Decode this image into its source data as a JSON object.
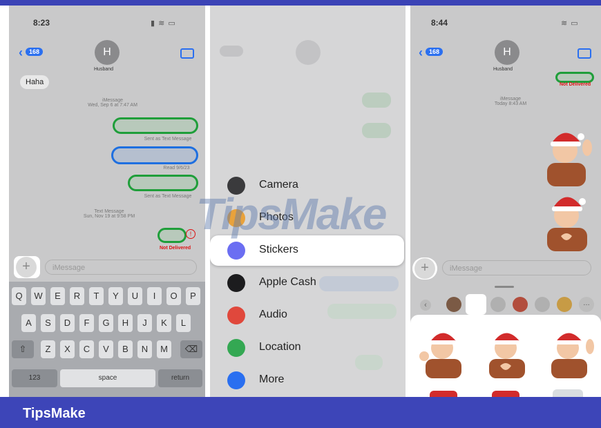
{
  "footer": {
    "title": "TipsMake"
  },
  "watermark": {
    "text": "TipsMake"
  },
  "panel_left": {
    "time": "8:23",
    "back_badge": "168",
    "avatar_initial": "H",
    "contact_name": "Husband",
    "incoming": "Haha",
    "meta1_line1": "iMessage",
    "meta1_line2": "Wed, Sep 6 at 7:47 AM",
    "sent_text_1": "Sent as Text Message",
    "read_receipt": "Read 9/6/23",
    "sent_text_2": "Sent as Text Message",
    "meta2_line1": "Text Message",
    "meta2_line2": "Sun, Nov 19 at 9:58 PM",
    "not_delivered": "Not Delivered",
    "input_placeholder": "iMessage",
    "keyboard_row1": [
      "Q",
      "W",
      "E",
      "R",
      "T",
      "Y",
      "U",
      "I",
      "O",
      "P"
    ],
    "keyboard_row2": [
      "A",
      "S",
      "D",
      "F",
      "G",
      "H",
      "J",
      "K",
      "L"
    ],
    "keyboard_row3": [
      "Z",
      "X",
      "C",
      "V",
      "B",
      "N",
      "M"
    ],
    "key_123": "123",
    "key_space": "space",
    "key_return": "return"
  },
  "panel_middle": {
    "menu": [
      {
        "label": "Camera",
        "icon": "camera-icon",
        "color": "#3a3a3c"
      },
      {
        "label": "Photos",
        "icon": "photos-icon",
        "color": "#e9a23b"
      },
      {
        "label": "Stickers",
        "icon": "stickers-icon",
        "color": "#6b6ef2"
      },
      {
        "label": "Apple Cash",
        "icon": "apple-cash-icon",
        "color": "#1c1c1e"
      },
      {
        "label": "Audio",
        "icon": "audio-icon",
        "color": "#e0483c"
      },
      {
        "label": "Location",
        "icon": "location-icon",
        "color": "#34a853"
      },
      {
        "label": "More",
        "icon": "more-icon",
        "color": "#2a6ff0"
      }
    ]
  },
  "panel_right": {
    "time": "8:44",
    "back_badge": "168",
    "avatar_initial": "H",
    "contact_name": "Husband",
    "not_delivered": "Not Delivered",
    "meta_line1": "iMessage",
    "meta_line2": "Today 8:43 AM",
    "input_placeholder": "iMessage"
  }
}
